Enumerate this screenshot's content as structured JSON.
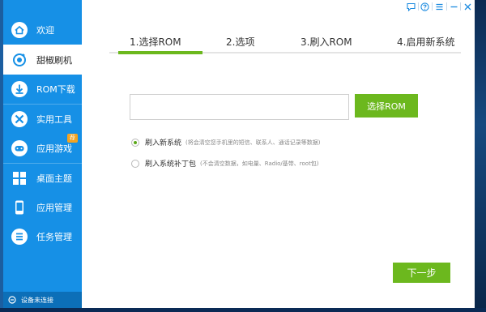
{
  "sidebar": {
    "items": [
      {
        "label": "欢迎",
        "icon": "home-icon"
      },
      {
        "label": "甜椒刷机",
        "icon": "refresh-icon"
      },
      {
        "label": "ROM下载",
        "icon": "download-icon"
      },
      {
        "label": "实用工具",
        "icon": "tools-icon"
      },
      {
        "label": "应用游戏",
        "icon": "gamepad-icon"
      },
      {
        "label": "桌面主题",
        "icon": "grid-icon"
      },
      {
        "label": "应用管理",
        "icon": "phone-icon"
      },
      {
        "label": "任务管理",
        "icon": "list-icon"
      }
    ],
    "badge": "荐",
    "footer": "设备未连接"
  },
  "steps": [
    "1.选择ROM",
    "2.选项",
    "3.刷入ROM",
    "4.启用新系统"
  ],
  "rom": {
    "input_value": "",
    "select_button": "选择ROM"
  },
  "options": [
    {
      "label": "刷入新系统",
      "hint": "(将会清空您手机里的短信、联系人、通话记录等数据)",
      "selected": true
    },
    {
      "label": "刷入系统补丁包",
      "hint": "(不会清空数据，如电量、Radio/基带、root包)",
      "selected": false
    }
  ],
  "next_button": "下一步",
  "colors": {
    "sidebar": "#1690e6",
    "accent_green": "#6cb81e",
    "badge": "#f3a321"
  }
}
